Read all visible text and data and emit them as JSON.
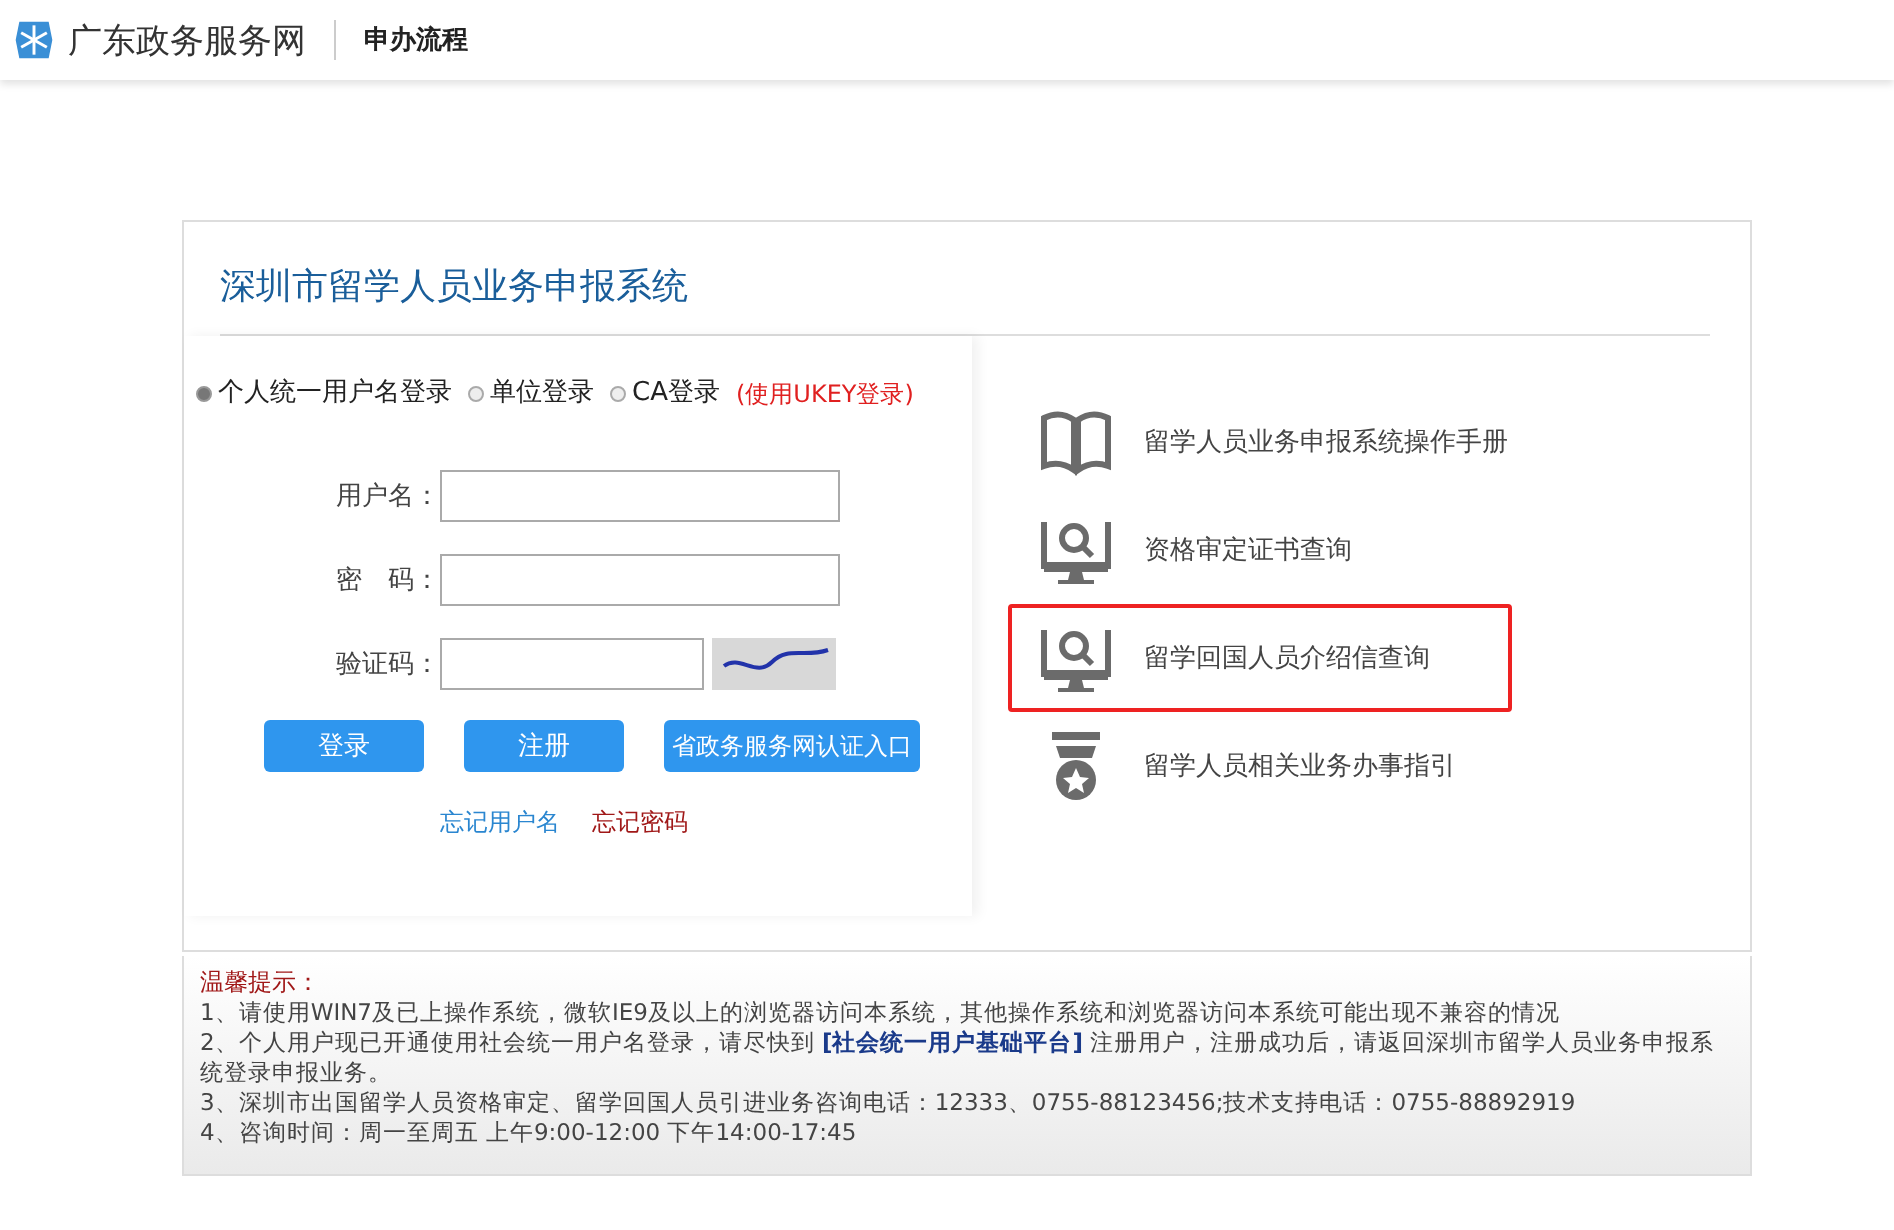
{
  "header": {
    "site_name": "广东政务服务网",
    "section": "申办流程"
  },
  "login": {
    "title": "深圳市留学人员业务申报系统",
    "login_types": [
      {
        "label": "个人统一用户名登录",
        "selected": true
      },
      {
        "label": "单位登录",
        "selected": false
      },
      {
        "label": "CA登录",
        "selected": false
      }
    ],
    "ca_hint": "(使用UKEY登录)",
    "fields": [
      {
        "label": "用户名：",
        "kind": "text"
      },
      {
        "label": "密　码：",
        "kind": "password"
      },
      {
        "label": "验证码：",
        "kind": "captcha"
      }
    ],
    "buttons": [
      "登录",
      "注册",
      "省政务服务网认证入口"
    ],
    "links": [
      {
        "label": "忘记用户名",
        "kind": "normal"
      },
      {
        "label": "忘记密码",
        "kind": "warning"
      }
    ]
  },
  "services": [
    {
      "label": "留学人员业务申报系统操作手册",
      "kind": "book",
      "highlighted": false
    },
    {
      "label": "资格审定证书查询",
      "kind": "monitor",
      "highlighted": false
    },
    {
      "label": "留学回国人员介绍信查询",
      "kind": "monitor",
      "highlighted": true
    },
    {
      "label": "留学人员相关业务办事指引",
      "kind": "medal",
      "highlighted": false
    }
  ],
  "notes": {
    "title": "温馨提示：",
    "items": [
      {
        "text": "1、请使用WIN7及已上操作系统，微软IE9及以上的浏览器访问本系统，其他操作系统和浏览器访问本系统可能出现不兼容的情况"
      },
      {
        "text": "2、个人用户现已开通使用社会统一用户名登录，请尽快到 ",
        "link": "[社会统一用户基础平台]",
        "after": " 注册用户，注册成功后，请返回深圳市留学人员业务申报系统登录申报业务。"
      },
      {
        "text": "3、深圳市出国留学人员资格审定、留学回国人员引进业务咨询电话：12333、0755-88123456;技术支持电话：0755-88892919"
      },
      {
        "text": "4、咨询时间：周一至周五 上午9:00-12:00 下午14:00-17:45"
      }
    ]
  }
}
